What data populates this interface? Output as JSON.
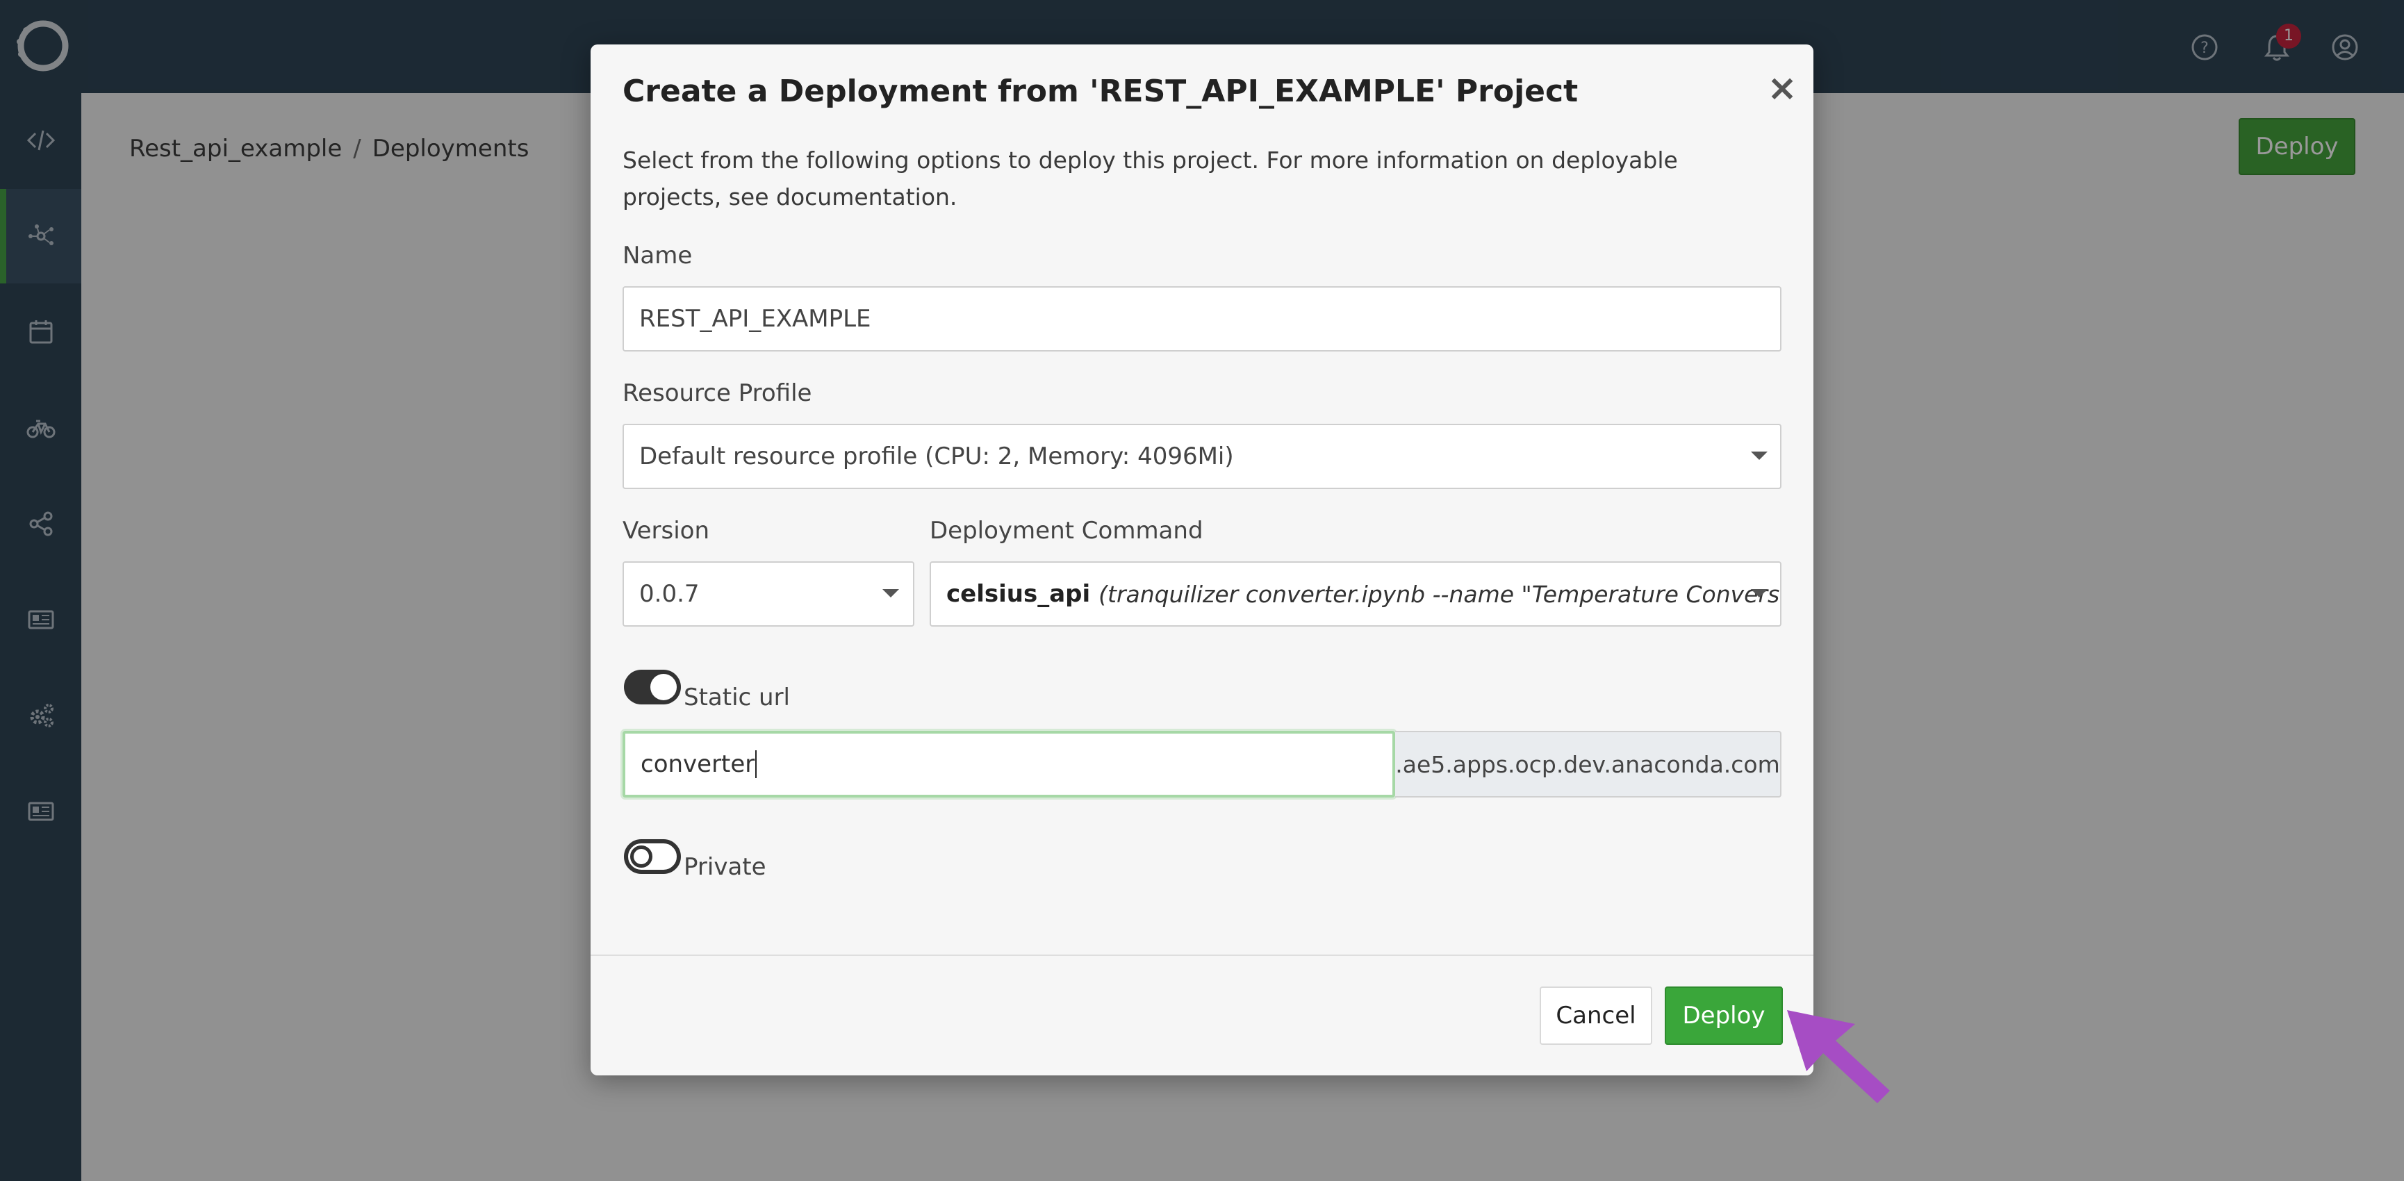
{
  "breadcrumb": {
    "project": "Rest_api_example",
    "separator": "/",
    "page": "Deployments"
  },
  "header": {
    "notification_count": "1",
    "deploy_label": "Deploy"
  },
  "modal": {
    "title": "Create a Deployment from 'REST_API_EXAMPLE' Project",
    "close_symbol": "×",
    "description": "Select from the following options to deploy this project. For more information on deployable projects, see documentation.",
    "name_label": "Name",
    "name_value": "REST_API_EXAMPLE",
    "resource_label": "Resource Profile",
    "resource_value": "Default resource profile (CPU: 2, Memory: 4096Mi)",
    "version_label": "Version",
    "version_value": "0.0.7",
    "command_label": "Deployment Command",
    "command_name": "celsius_api",
    "command_detail": "(tranquilizer converter.ipynb --name \"Temperature Conversion\")",
    "static_url_label": "Static url",
    "static_url_enabled": true,
    "static_url_value": "converter",
    "static_url_suffix": ".ae5.apps.ocp.dev.anaconda.com",
    "private_label": "Private",
    "private_enabled": false,
    "cancel_label": "Cancel",
    "deploy_label": "Deploy"
  },
  "colors": {
    "topbar": "#2f4556",
    "primary_green": "#3aa63a",
    "annotation_arrow": "#a64dc4",
    "badge": "#c9243f"
  },
  "icons": [
    "logo-icon",
    "code-icon",
    "deployments-icon",
    "calendar-icon",
    "bike-icon",
    "share-icon",
    "news-icon",
    "settings-icon",
    "news-icon",
    "help-icon",
    "bell-icon",
    "user-icon"
  ]
}
